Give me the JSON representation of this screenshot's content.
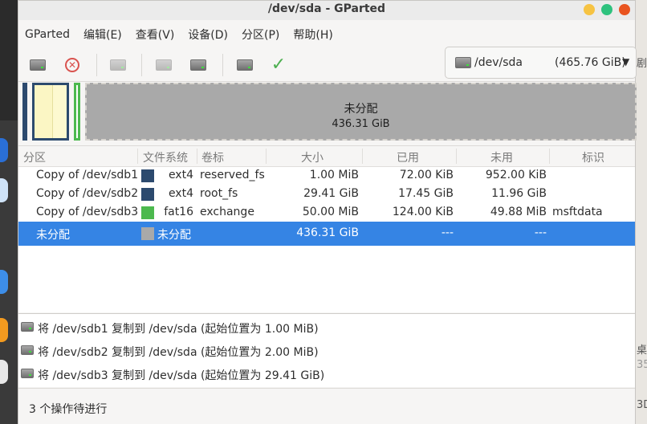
{
  "window": {
    "title": "/dev/sda - GParted"
  },
  "menu": [
    "GParted",
    "编辑(E)",
    "查看(V)",
    "设备(D)",
    "分区(P)",
    "帮助(H)"
  ],
  "device": {
    "name": "/dev/sda",
    "size": "(465.76 GiB)"
  },
  "disk_map": {
    "unallocated_label": "未分配",
    "unallocated_size": "436.31 GiB"
  },
  "columns": [
    "分区",
    "文件系统",
    "卷标",
    "大小",
    "已用",
    "未用",
    "标识"
  ],
  "partitions": [
    {
      "name": "Copy of /dev/sdb1",
      "fs": "ext4",
      "color": "#2c4a6e",
      "label": "reserved_fs",
      "size": "1.00 MiB",
      "used": "72.00 KiB",
      "unused": "952.00 KiB",
      "flags": ""
    },
    {
      "name": "Copy of /dev/sdb2",
      "fs": "ext4",
      "color": "#2c4a6e",
      "label": "root_fs",
      "size": "29.41 GiB",
      "used": "17.45 GiB",
      "unused": "11.96 GiB",
      "flags": ""
    },
    {
      "name": "Copy of /dev/sdb3",
      "fs": "fat16",
      "color": "#4cb94e",
      "label": "exchange",
      "size": "50.00 MiB",
      "used": "124.00 KiB",
      "unused": "49.88 MiB",
      "flags": "msftdata"
    },
    {
      "name": "未分配",
      "fs": "未分配",
      "color": "#a9a9a9",
      "label": "",
      "size": "436.31 GiB",
      "used": "---",
      "unused": "---",
      "flags": ""
    }
  ],
  "operations": [
    "将 /dev/sdb1 复制到 /dev/sda (起始位置为 1.00 MiB)",
    "将 /dev/sdb2 复制到 /dev/sda (起始位置为 2.00 MiB)",
    "将 /dev/sdb3 复制到 /dev/sda (起始位置为 29.41 GiB)"
  ],
  "status": "3 个操作待进行",
  "desktop_fragments": [
    "剧",
    "桌",
    "35",
    "3D"
  ],
  "colors": {
    "selection": "#3584e4",
    "ext4": "#2c4a6e",
    "fat16": "#4cb94e",
    "unallocated": "#a9a9a9"
  }
}
